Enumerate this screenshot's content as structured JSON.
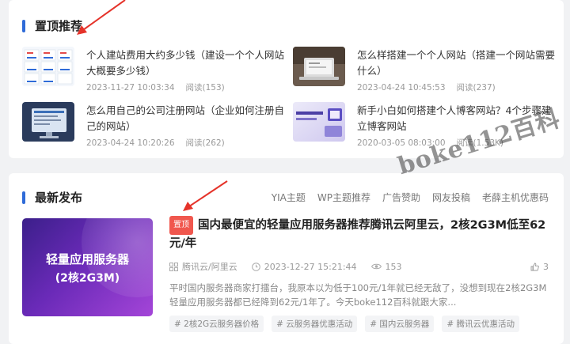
{
  "pinned": {
    "title": "置顶推荐",
    "items": [
      {
        "title": "个人建站费用大约多少钱（建设一个个人网站大概要多少钱）",
        "date": "2023-11-27 10:03:34",
        "views": "阅读(153)"
      },
      {
        "title": "怎么样搭建一个个人网站（搭建一个网站需要什么）",
        "date": "2023-04-24 10:45:53",
        "views": "阅读(237)"
      },
      {
        "title": "怎么用自己的公司注册网站（企业如何注册自己的网站）",
        "date": "2023-04-24 10:20:26",
        "views": "阅读(262)"
      },
      {
        "title": "新手小白如何搭建个人博客网站？4个步骤建立博客网站",
        "date": "2020-03-05 08:03:00",
        "views": "阅读(1.53K)"
      }
    ]
  },
  "latest": {
    "title": "最新发布",
    "tabs": [
      "YIA主题",
      "WP主题推荐",
      "广告赞助",
      "网友投稿",
      "老薛主机优惠码"
    ],
    "post": {
      "badge": "置顶",
      "title": "国内最便宜的轻量应用服务器推荐腾讯云阿里云，2核2G3M低至62元/年",
      "image_caption_1": "轻量应用服务器",
      "image_caption_2": "(2核2G3M)",
      "category": "腾讯云/阿里云",
      "datetime": "2023-12-27 15:21:44",
      "views": "153",
      "likes": "3",
      "excerpt": "平时国内服务器商家打擂台，我原本以为低于100元/1年就已经无敌了，没想到现在2核2G3M轻量应用服务器都已经降到62元/1年了。今天boke112百科就跟大家...",
      "tags": [
        "# 2核2G云服务器价格",
        "# 云服务器优惠活动",
        "# 国内云服务器",
        "# 腾讯云优惠活动"
      ]
    }
  },
  "watermark": "boke112百科",
  "colors": {
    "accent": "#2f6bd8",
    "badge": "#f0574e",
    "arrow": "#e5332a"
  }
}
